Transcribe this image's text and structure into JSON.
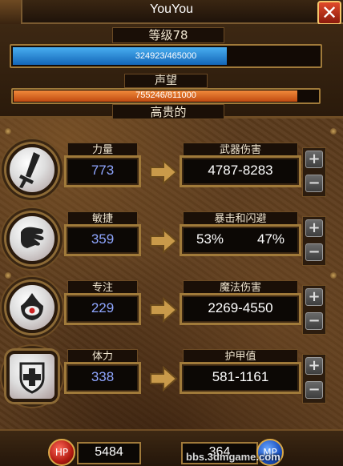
{
  "header": {
    "title": "YouYou",
    "close_label": "✕"
  },
  "level": {
    "label": "等级78",
    "current_xp": 324923,
    "max_xp": 465000,
    "text": "324923/465000"
  },
  "reputation": {
    "label": "声望",
    "current": 755246,
    "max": 811000,
    "text": "755246/811000",
    "rank": "高贵的"
  },
  "colors": {
    "xp_bar": "#1e80d8",
    "rep_bar": "#e06820",
    "stat_value": "#8fa6ff",
    "frame": "#a07a3a"
  },
  "stats": [
    {
      "icon": "sword-icon",
      "name": "力量",
      "value": "773",
      "result_label": "武器伤害",
      "result": "4787-8283"
    },
    {
      "icon": "fist-icon",
      "name": "敏捷",
      "value": "359",
      "result_label": "暴击和闪避",
      "result_a": "53%",
      "result_b": "47%"
    },
    {
      "icon": "eye-flame-icon",
      "name": "专注",
      "value": "229",
      "result_label": "魔法伤害",
      "result": "2269-4550"
    },
    {
      "icon": "shield-cross-icon",
      "name": "体力",
      "value": "338",
      "result_label": "护甲值",
      "result": "581-1161"
    }
  ],
  "buttons": {
    "plus": "+",
    "minus": "−"
  },
  "footer": {
    "hp_label": "HP",
    "hp_value": "5484",
    "mp_label": "MP",
    "mp_value": "364",
    "watermark": "bbs.3dmgame.com"
  }
}
